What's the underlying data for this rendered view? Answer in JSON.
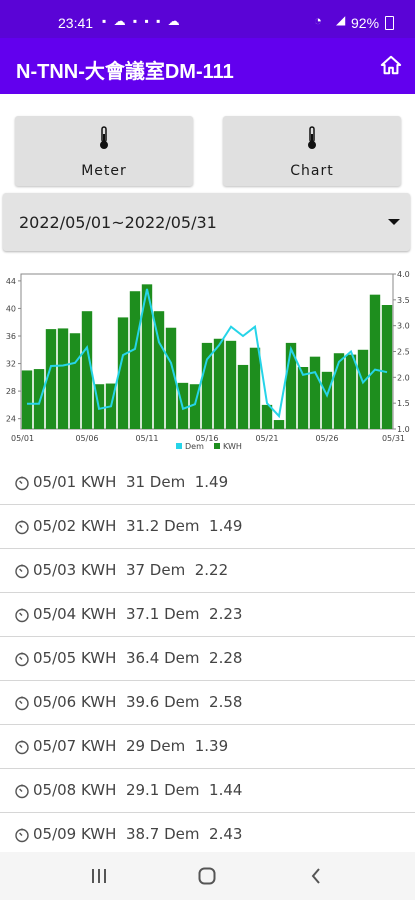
{
  "status_bar": {
    "time": "23:41",
    "battery": "92%"
  },
  "app_bar": {
    "title": "N-TNN-大會議室DM-111"
  },
  "buttons": {
    "meter_label": "Meter",
    "chart_label": "Chart"
  },
  "date_range": {
    "selected": "2022/05/01~2022/05/31"
  },
  "chart_data": {
    "type": "bar",
    "categories": [
      "05/01",
      "05/02",
      "05/03",
      "05/04",
      "05/05",
      "05/06",
      "05/07",
      "05/08",
      "05/09",
      "05/10",
      "05/11",
      "05/12",
      "05/13",
      "05/14",
      "05/15",
      "05/16",
      "05/17",
      "05/18",
      "05/19",
      "05/20",
      "05/21",
      "05/22",
      "05/23",
      "05/24",
      "05/25",
      "05/26",
      "05/27",
      "05/28",
      "05/29",
      "05/30",
      "05/31"
    ],
    "x_tick_labels": [
      "05/01",
      "05/06",
      "05/11",
      "05/16",
      "05/21",
      "05/26",
      "05/31"
    ],
    "series": [
      {
        "name": "KWH",
        "type": "bar",
        "axis": "left",
        "color": "#1e8e1e",
        "values": [
          31,
          31.2,
          37,
          37.1,
          36.4,
          39.6,
          29,
          29.1,
          38.7,
          42.5,
          43.5,
          39.6,
          37.2,
          29.2,
          29,
          35,
          35.6,
          35.3,
          31.8,
          34.3,
          26,
          23.8,
          35,
          31.5,
          33,
          30.8,
          33.5,
          33.3,
          34,
          42,
          40.5
        ]
      },
      {
        "name": "Dem",
        "type": "line",
        "axis": "right",
        "color": "#26d4e8",
        "values": [
          1.49,
          1.49,
          2.22,
          2.23,
          2.28,
          2.58,
          1.39,
          1.44,
          2.43,
          2.55,
          3.71,
          2.68,
          2.28,
          1.39,
          1.48,
          2.35,
          2.62,
          2.98,
          2.8,
          2.98,
          1.5,
          1.25,
          2.55,
          2.05,
          2.1,
          1.65,
          2.3,
          2.5,
          1.9,
          2.15,
          2.1
        ]
      }
    ],
    "y_left": {
      "ticks": [
        24,
        28,
        32,
        36,
        40,
        44
      ],
      "range": [
        22.5,
        45
      ]
    },
    "y_right": {
      "ticks": [
        "1.0",
        "1.5",
        "2.0",
        "2.5",
        "3.0",
        "3.5",
        "4.0"
      ],
      "range": [
        1.0,
        4.0
      ]
    },
    "legend_position": "bottom-center",
    "grid": false
  },
  "readings": [
    {
      "date": "05/01",
      "kwh": "31",
      "dem": "1.49"
    },
    {
      "date": "05/02",
      "kwh": "31.2",
      "dem": "1.49"
    },
    {
      "date": "05/03",
      "kwh": "37",
      "dem": "2.22"
    },
    {
      "date": "05/04",
      "kwh": "37.1",
      "dem": "2.23"
    },
    {
      "date": "05/05",
      "kwh": "36.4",
      "dem": "2.28"
    },
    {
      "date": "05/06",
      "kwh": "39.6",
      "dem": "2.58"
    },
    {
      "date": "05/07",
      "kwh": "29",
      "dem": "1.39"
    },
    {
      "date": "05/08",
      "kwh": "29.1",
      "dem": "1.44"
    },
    {
      "date": "05/09",
      "kwh": "38.7",
      "dem": "2.43"
    }
  ],
  "labels": {
    "kwh": "KWH",
    "dem": "Dem"
  },
  "icons": {
    "home": "home-icon",
    "meter": "thermometer-icon",
    "chart": "thermometer-icon",
    "row": "timer-icon"
  },
  "colors": {
    "status_bar": "#5a04d6",
    "app_bar": "#6200ee",
    "bar": "#1e8e1e",
    "line": "#26d4e8"
  }
}
